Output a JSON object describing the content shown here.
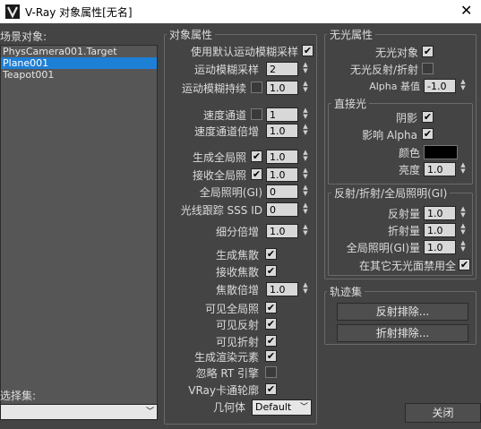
{
  "window": {
    "title": "V-Ray 对象属性[无名]",
    "close_label": "✕"
  },
  "scene": {
    "label": "场景对象:",
    "items": [
      {
        "name": "PhysCamera001.Target",
        "selected": false
      },
      {
        "name": "Plane001",
        "selected": true
      },
      {
        "name": "Teapot001",
        "selected": false
      }
    ],
    "selection_set_label": "选择集:",
    "selection_set_value": ""
  },
  "object_props": {
    "title": "对象属性",
    "use_default_mb": {
      "label": "使用默认运动模糊采样",
      "checked": true
    },
    "mb_samples": {
      "label": "运动模糊采样",
      "value": "2"
    },
    "mb_duration": {
      "label": "运动模糊持续",
      "checked": false,
      "value": "1.0"
    },
    "velocity_channel": {
      "label": "速度通道",
      "checked": false,
      "value": "1"
    },
    "velocity_mult": {
      "label": "速度通道倍增",
      "value": "1.0"
    },
    "generate_gi": {
      "label": "生成全局照",
      "checked": true,
      "value": "1.0"
    },
    "receive_gi": {
      "label": "接收全局照",
      "checked": true,
      "value": "1.0"
    },
    "gi_surface_id": {
      "label": "全局照明(GI)",
      "value": "0"
    },
    "raytrace_sss_id": {
      "label": "光线跟踪 SSS ID",
      "value": "0"
    },
    "subdiv_mult": {
      "label": "细分倍增",
      "value": "1.0"
    },
    "generate_caustics": {
      "label": "生成焦散",
      "checked": true
    },
    "receive_caustics": {
      "label": "接收焦散",
      "checked": true
    },
    "caustics_mult": {
      "label": "焦散倍增",
      "value": "1.0"
    },
    "visible_to_gi": {
      "label": "可见全局照",
      "checked": true
    },
    "visible_reflect": {
      "label": "可见反射",
      "checked": true
    },
    "visible_refract": {
      "label": "可见折射",
      "checked": true
    },
    "generate_render_elements": {
      "label": "生成渲染元素",
      "checked": true
    },
    "ignore_rt": {
      "label": "忽略 RT 引擎",
      "checked": false
    },
    "vray_toon": {
      "label": "VRay卡通轮廓",
      "checked": true
    },
    "geometry": {
      "label": "几何体",
      "value": "Default"
    }
  },
  "matte": {
    "title": "无光属性",
    "matte_object": {
      "label": "无光对象",
      "checked": true
    },
    "matte_reflect": {
      "label": "无光反射/折射",
      "checked": false
    },
    "alpha_contrib": {
      "label": "Alpha 基值",
      "value": "-1.0"
    },
    "direct_light": {
      "title": "直接光",
      "shadows": {
        "label": "阴影",
        "checked": true
      },
      "affect_alpha": {
        "label": "影响 Alpha",
        "checked": true
      },
      "color": {
        "label": "颜色",
        "value": "#000000"
      },
      "brightness": {
        "label": "亮度",
        "value": "1.0"
      }
    },
    "refl_gi": {
      "title": "反射/折射/全局照明(GI)",
      "reflection": {
        "label": "反射量",
        "value": "1.0"
      },
      "refraction": {
        "label": "折射量",
        "value": "1.0"
      },
      "gi_amount": {
        "label": "全局照明(GI)量",
        "value": "1.0"
      },
      "no_gi_other": {
        "label": "在其它无光面禁用全",
        "checked": true
      }
    }
  },
  "trace_sets": {
    "title": "轨迹集",
    "reflect_exclude": "反射排除...",
    "refract_exclude": "折射排除..."
  },
  "close_button": "关闭"
}
